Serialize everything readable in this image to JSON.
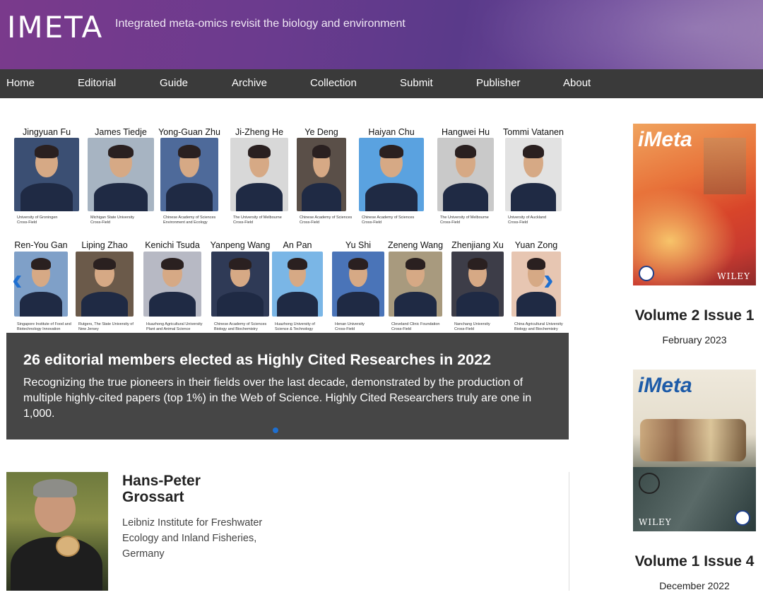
{
  "header": {
    "logo": "IMETA",
    "tagline": "Integrated meta-omics revisit the biology and environment"
  },
  "nav": [
    "Home",
    "Editorial",
    "Guide",
    "Archive",
    "Collection",
    "Submit",
    "Publisher",
    "About"
  ],
  "carousel": {
    "row1": [
      {
        "name": "Jingyuan Fu",
        "affil": "University of Groningen\nCross-Field"
      },
      {
        "name": "James Tiedje",
        "affil": "Michigan State University\nCross-Field"
      },
      {
        "name": "Yong-Guan Zhu",
        "affil": "Chinese Academy of Sciences\nEnvironment and Ecology"
      },
      {
        "name": "Ji-Zheng He",
        "affil": "The University of Melbourne\nCross-Field"
      },
      {
        "name": "Ye Deng",
        "affil": "Chinese Academy of Sciences\nCross-Field"
      },
      {
        "name": "Haiyan Chu",
        "affil": "Chinese Academy of Sciences\nCross-Field"
      },
      {
        "name": "Hangwei Hu",
        "affil": "The University of Melbourne\nCross-Field"
      },
      {
        "name": "Tommi Vatanen",
        "affil": "University of Auckland\nCross-Field"
      }
    ],
    "row2": [
      {
        "name": "Ren-You Gan",
        "affil": "Singapore Institute of Food and\nBiotechnology Innovation"
      },
      {
        "name": "Liping Zhao",
        "affil": "Rutgers, The State University of\nNew Jersey"
      },
      {
        "name": "Kenichi Tsuda",
        "affil": "Huazhong Agricultural University\nPlant and Animal Science"
      },
      {
        "name": "Yanpeng Wang",
        "affil": "Chinese Academy of Sciences\nBiology and Biochemistry"
      },
      {
        "name": "An Pan",
        "affil": "Huazhong University of\nScience & Technology"
      },
      {
        "name": "Yu Shi",
        "affil": "Henan University\nCross-Field"
      },
      {
        "name": "Zeneng Wang",
        "affil": "Cleveland Clinic Foundation\nCross-Field"
      },
      {
        "name": "Zhenjiang Xu",
        "affil": "Nanchang University\nCross-Field"
      },
      {
        "name": "Yuan Zong",
        "affil": "China Agricultural University\nBiology and Biochemistry"
      }
    ],
    "prev_label": "‹",
    "next_label": "›",
    "caption_title": "26 editorial members elected as Highly Cited Researches in 2022",
    "caption_text": "Recognizing the true pioneers in their fields over the last decade, demonstrated by the production of multiple highly-cited papers (top 1%) in the Web of Science. Highly Cited Researchers truly are one in 1,000."
  },
  "featured": {
    "name_line1": "Hans-Peter",
    "name_line2": "Grossart",
    "affil_line1": "Leibniz Institute for Freshwater",
    "affil_line2": "Ecology and Inland Fisheries,",
    "affil_line3": "Germany"
  },
  "issues": [
    {
      "cover_title": "iMeta",
      "publisher": "WILEY",
      "volume": "Volume 2 Issue 1",
      "date": "February 2023"
    },
    {
      "cover_title": "iMeta",
      "publisher": "WILEY",
      "volume": "Volume 1 Issue 4",
      "date": "December 2022"
    }
  ]
}
